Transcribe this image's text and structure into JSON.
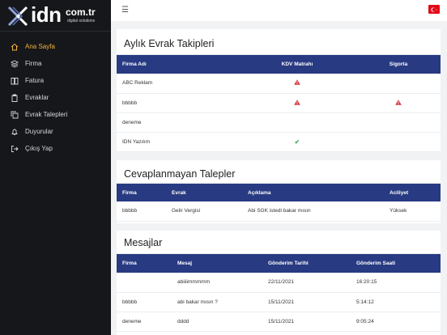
{
  "brand": {
    "logo_main": "idn",
    "logo_domain": "com.tr",
    "logo_tagline": "digital solutions"
  },
  "sidebar": {
    "items": [
      {
        "label": "Ana Sayfa",
        "icon": "home-icon",
        "active": true
      },
      {
        "label": "Firma",
        "icon": "layers-icon"
      },
      {
        "label": "Fatura",
        "icon": "book-icon"
      },
      {
        "label": "Evraklar",
        "icon": "clipboard-icon"
      },
      {
        "label": "Evrak Talepleri",
        "icon": "copy-icon"
      },
      {
        "label": "Duyurular",
        "icon": "bell-icon"
      },
      {
        "label": "Çıkış Yap",
        "icon": "logout-icon"
      }
    ]
  },
  "header": {
    "menu_icon": "hamburger-icon",
    "flag_icon": "turkey-flag-icon"
  },
  "evrak": {
    "title": "Aylık Evrak Takipleri",
    "columns": [
      "Firma Adı",
      "KDV Matrahı",
      "Sigorta"
    ],
    "rows": [
      {
        "firma": "ABC Reklam",
        "kdv": "warning",
        "sigorta": ""
      },
      {
        "firma": "bbbbb",
        "kdv": "warning",
        "sigorta": "warning"
      },
      {
        "firma": "deneme",
        "kdv": "",
        "sigorta": ""
      },
      {
        "firma": "IDN Yazılım",
        "kdv": "check",
        "sigorta": ""
      }
    ]
  },
  "talepler": {
    "title": "Cevaplanmayan Talepler",
    "columns": [
      "Firma",
      "Evrak",
      "Açıklama",
      "Aciliyet"
    ],
    "rows": [
      {
        "firma": "bbbbb",
        "evrak": "Gelir Vergisi",
        "aciklama": "Abi SGK istedi bakar mısın",
        "aciliyet": "Yüksek"
      }
    ]
  },
  "mesajlar": {
    "title": "Mesajlar",
    "columns": [
      "Firma",
      "Mesaj",
      "Gönderim Tarihi",
      "Gönderim Saati"
    ],
    "rows": [
      {
        "firma": "",
        "mesaj": "abiiiimmmmm",
        "tarih": "22/11/2021",
        "saat": "16:20:15"
      },
      {
        "firma": "bbbbb",
        "mesaj": "abi bakar mısın ?",
        "tarih": "15/11/2021",
        "saat": "5:14:12"
      },
      {
        "firma": "deneme",
        "mesaj": "dddd",
        "tarih": "15/11/2021",
        "saat": "9:05:24"
      }
    ]
  },
  "colors": {
    "sidebar": "#15171a",
    "accent": "#f0b339",
    "table_header": "#283a82",
    "warning": "#d9363e",
    "success": "#1e9e4c"
  }
}
